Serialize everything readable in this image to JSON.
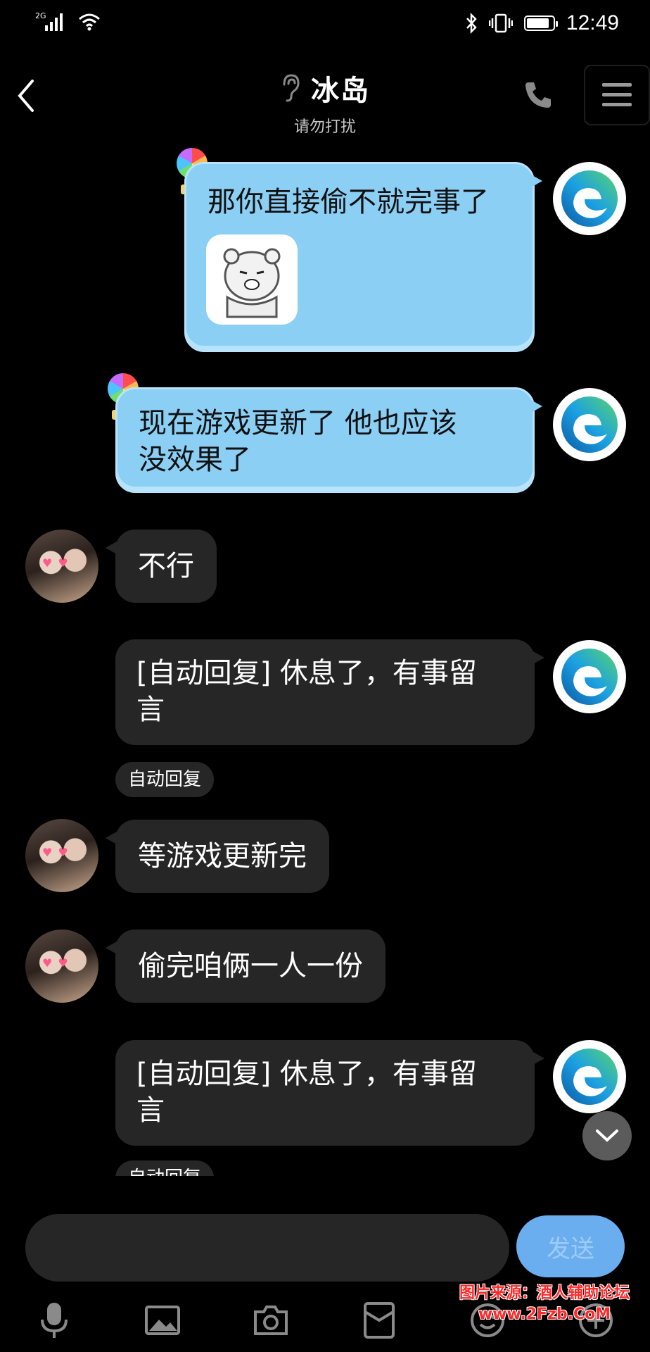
{
  "status_bar": {
    "network": "2G",
    "time": "12:49",
    "battery_level": 0.85,
    "icons": [
      "signal-icon",
      "wifi-icon",
      "bluetooth-icon",
      "vibrate-icon",
      "battery-icon"
    ]
  },
  "header": {
    "title": "冰岛",
    "subtitle": "请勿打扰",
    "icons": [
      "back-icon",
      "ear-icon",
      "phone-icon",
      "menu-icon"
    ]
  },
  "messages": [
    {
      "from": "self",
      "style": "blue",
      "text": "那你直接偷不就完事了",
      "has_sticker": true
    },
    {
      "from": "self",
      "style": "blue",
      "text_lines": [
        "现在游戏更新了 他也应该",
        "没效果了"
      ]
    },
    {
      "from": "other",
      "text": "不行"
    },
    {
      "from": "self",
      "style": "dark",
      "text_lines": [
        "[自动回复] 休息了，有事留",
        "言"
      ],
      "tag": "自动回复"
    },
    {
      "from": "other",
      "text": "等游戏更新完"
    },
    {
      "from": "other",
      "text": "偷完咱俩一人一份"
    },
    {
      "from": "self",
      "style": "dark",
      "text_lines": [
        "[自动回复] 休息了，有事留",
        "言"
      ],
      "tag": "自动回复"
    }
  ],
  "input": {
    "value": "",
    "send_label": "发送"
  },
  "toolbar": {
    "icons": [
      "microphone-icon",
      "image-icon",
      "camera-icon",
      "red-packet-icon",
      "emoji-icon",
      "plus-icon"
    ]
  },
  "watermark": {
    "line1": "图片来源：酒人辅助论坛",
    "line2": "www.2Fzb.CoM"
  },
  "colors": {
    "background": "#000000",
    "blue_bubble": "#8ccff5",
    "dark_bubble": "#262626",
    "send_button": "#6aaef0"
  }
}
